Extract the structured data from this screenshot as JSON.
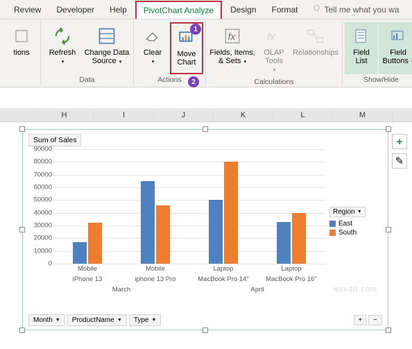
{
  "ribbon": {
    "tabs": [
      "Review",
      "Developer",
      "Help",
      "PivotChart Analyze",
      "Design",
      "Format"
    ],
    "active_tab": 3,
    "tell_me": "Tell me what you wa",
    "groups": {
      "partial_left": {
        "btn": "tions"
      },
      "data": {
        "label": "Data",
        "refresh": "Refresh",
        "change_data": "Change Data Source"
      },
      "actions": {
        "label": "Actions",
        "clear": "Clear",
        "move": "Move Chart",
        "badge1": "1",
        "badge2": "2"
      },
      "calculations": {
        "label": "Calculations",
        "fields": "Fields, Items, & Sets",
        "olap": "OLAP Tools",
        "rel": "Relationships"
      },
      "showhide": {
        "label": "Show/Hide",
        "fieldlist": "Field List",
        "fieldbtns": "Field Buttons"
      }
    }
  },
  "columns": [
    "",
    "H",
    "I",
    "J",
    "K",
    "L",
    "M"
  ],
  "chart_data": {
    "type": "bar",
    "title": "Sum of Sales",
    "ylim": [
      0,
      90000
    ],
    "yticks": [
      0,
      10000,
      20000,
      30000,
      40000,
      50000,
      60000,
      70000,
      80000,
      90000
    ],
    "hier_x": {
      "level1": [
        "Mobile",
        "Mobile",
        "Laptop",
        "Laptop"
      ],
      "level2": [
        "iPhone 13",
        "iphone 13 Pro",
        "MacBook Pro 14\"",
        "MacBook Pro 16\""
      ],
      "level3": [
        "March",
        "April"
      ]
    },
    "series": [
      {
        "name": "East",
        "color": "#4e81bd",
        "values": [
          17000,
          65000,
          50000,
          33000
        ]
      },
      {
        "name": "South",
        "color": "#ed7d31",
        "values": [
          32000,
          46000,
          80000,
          40000
        ]
      }
    ],
    "legend_title": "Region",
    "filters": [
      "Month",
      "ProductName",
      "Type"
    ],
    "side_buttons": {
      "add": "+",
      "brush": "✎"
    },
    "zoom": {
      "plus": "+",
      "minus": "−"
    }
  },
  "watermark": "wsxdn.com"
}
